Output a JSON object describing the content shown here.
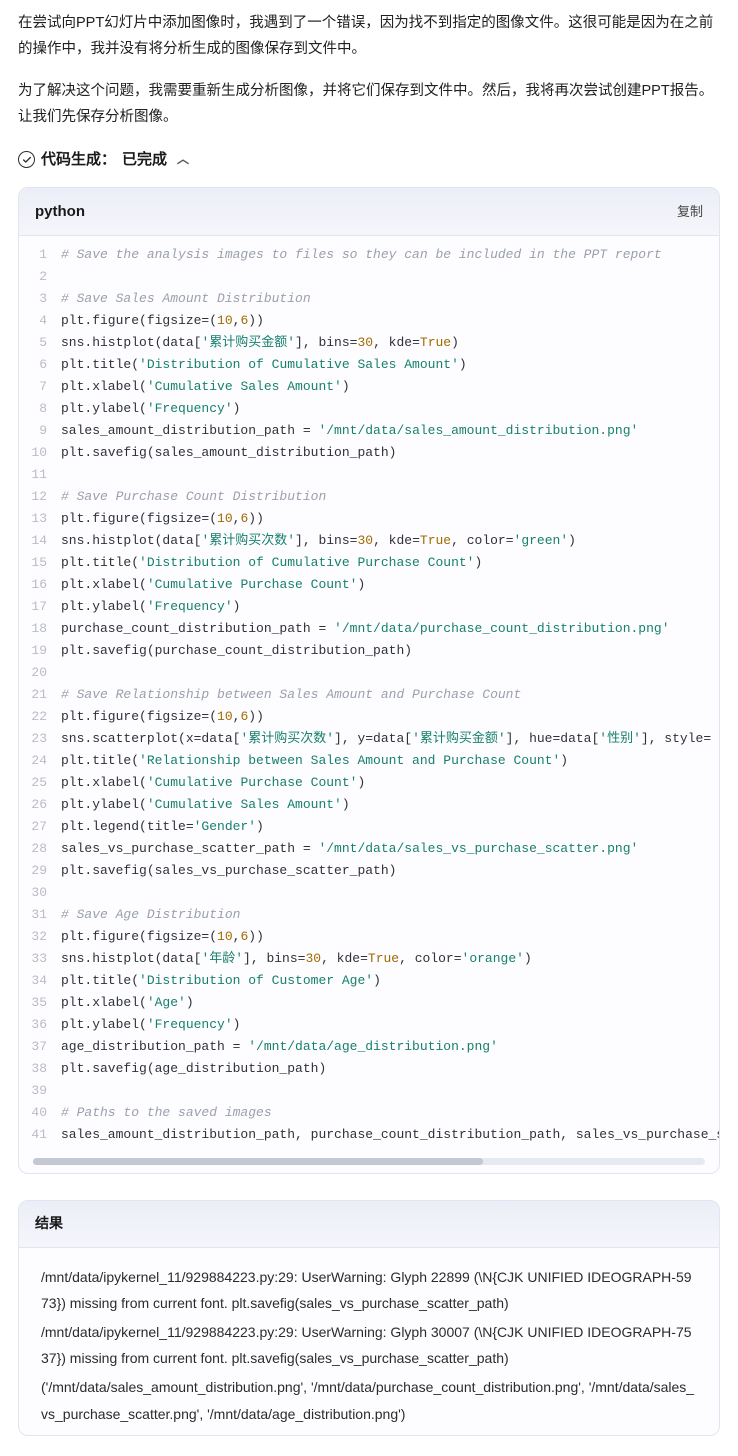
{
  "prose": {
    "p1": "在尝试向PPT幻灯片中添加图像时，我遇到了一个错误，因为找不到指定的图像文件。这很可能是因为在之前的操作中，我并没有将分析生成的图像保存到文件中。",
    "p2": "为了解决这个问题，我需要重新生成分析图像，并将它们保存到文件中。然后，我将再次尝试创建PPT报告。让我们先保存分析图像。"
  },
  "codegen": {
    "label": "代码生成：",
    "status": "已完成"
  },
  "codebox": {
    "lang": "python",
    "copy": "复制",
    "lines": [
      [
        {
          "t": "# Save the analysis images to files so they can be included in the PPT report",
          "c": "c-comment"
        }
      ],
      [],
      [
        {
          "t": "# Save Sales Amount Distribution",
          "c": "c-comment"
        }
      ],
      [
        {
          "t": "plt.figure(figsize=(",
          "c": "c-id"
        },
        {
          "t": "10",
          "c": "c-num"
        },
        {
          "t": ",",
          "c": "c-id"
        },
        {
          "t": "6",
          "c": "c-num"
        },
        {
          "t": "))",
          "c": "c-id"
        }
      ],
      [
        {
          "t": "sns.histplot(data[",
          "c": "c-id"
        },
        {
          "t": "'累计购买金额'",
          "c": "c-str"
        },
        {
          "t": "], bins=",
          "c": "c-id"
        },
        {
          "t": "30",
          "c": "c-num"
        },
        {
          "t": ", kde=",
          "c": "c-id"
        },
        {
          "t": "True",
          "c": "c-kw"
        },
        {
          "t": ")",
          "c": "c-id"
        }
      ],
      [
        {
          "t": "plt.title(",
          "c": "c-id"
        },
        {
          "t": "'Distribution of Cumulative Sales Amount'",
          "c": "c-str"
        },
        {
          "t": ")",
          "c": "c-id"
        }
      ],
      [
        {
          "t": "plt.xlabel(",
          "c": "c-id"
        },
        {
          "t": "'Cumulative Sales Amount'",
          "c": "c-str"
        },
        {
          "t": ")",
          "c": "c-id"
        }
      ],
      [
        {
          "t": "plt.ylabel(",
          "c": "c-id"
        },
        {
          "t": "'Frequency'",
          "c": "c-str"
        },
        {
          "t": ")",
          "c": "c-id"
        }
      ],
      [
        {
          "t": "sales_amount_distribution_path = ",
          "c": "c-id"
        },
        {
          "t": "'/mnt/data/sales_amount_distribution.png'",
          "c": "c-str"
        }
      ],
      [
        {
          "t": "plt.savefig(sales_amount_distribution_path)",
          "c": "c-id"
        }
      ],
      [],
      [
        {
          "t": "# Save Purchase Count Distribution",
          "c": "c-comment"
        }
      ],
      [
        {
          "t": "plt.figure(figsize=(",
          "c": "c-id"
        },
        {
          "t": "10",
          "c": "c-num"
        },
        {
          "t": ",",
          "c": "c-id"
        },
        {
          "t": "6",
          "c": "c-num"
        },
        {
          "t": "))",
          "c": "c-id"
        }
      ],
      [
        {
          "t": "sns.histplot(data[",
          "c": "c-id"
        },
        {
          "t": "'累计购买次数'",
          "c": "c-str"
        },
        {
          "t": "], bins=",
          "c": "c-id"
        },
        {
          "t": "30",
          "c": "c-num"
        },
        {
          "t": ", kde=",
          "c": "c-id"
        },
        {
          "t": "True",
          "c": "c-kw"
        },
        {
          "t": ", color=",
          "c": "c-id"
        },
        {
          "t": "'green'",
          "c": "c-str"
        },
        {
          "t": ")",
          "c": "c-id"
        }
      ],
      [
        {
          "t": "plt.title(",
          "c": "c-id"
        },
        {
          "t": "'Distribution of Cumulative Purchase Count'",
          "c": "c-str"
        },
        {
          "t": ")",
          "c": "c-id"
        }
      ],
      [
        {
          "t": "plt.xlabel(",
          "c": "c-id"
        },
        {
          "t": "'Cumulative Purchase Count'",
          "c": "c-str"
        },
        {
          "t": ")",
          "c": "c-id"
        }
      ],
      [
        {
          "t": "plt.ylabel(",
          "c": "c-id"
        },
        {
          "t": "'Frequency'",
          "c": "c-str"
        },
        {
          "t": ")",
          "c": "c-id"
        }
      ],
      [
        {
          "t": "purchase_count_distribution_path = ",
          "c": "c-id"
        },
        {
          "t": "'/mnt/data/purchase_count_distribution.png'",
          "c": "c-str"
        }
      ],
      [
        {
          "t": "plt.savefig(purchase_count_distribution_path)",
          "c": "c-id"
        }
      ],
      [],
      [
        {
          "t": "# Save Relationship between Sales Amount and Purchase Count",
          "c": "c-comment"
        }
      ],
      [
        {
          "t": "plt.figure(figsize=(",
          "c": "c-id"
        },
        {
          "t": "10",
          "c": "c-num"
        },
        {
          "t": ",",
          "c": "c-id"
        },
        {
          "t": "6",
          "c": "c-num"
        },
        {
          "t": "))",
          "c": "c-id"
        }
      ],
      [
        {
          "t": "sns.scatterplot(x=data[",
          "c": "c-id"
        },
        {
          "t": "'累计购买次数'",
          "c": "c-str"
        },
        {
          "t": "], y=data[",
          "c": "c-id"
        },
        {
          "t": "'累计购买金额'",
          "c": "c-str"
        },
        {
          "t": "], hue=data[",
          "c": "c-id"
        },
        {
          "t": "'性别'",
          "c": "c-str"
        },
        {
          "t": "], style=",
          "c": "c-id"
        }
      ],
      [
        {
          "t": "plt.title(",
          "c": "c-id"
        },
        {
          "t": "'Relationship between Sales Amount and Purchase Count'",
          "c": "c-str"
        },
        {
          "t": ")",
          "c": "c-id"
        }
      ],
      [
        {
          "t": "plt.xlabel(",
          "c": "c-id"
        },
        {
          "t": "'Cumulative Purchase Count'",
          "c": "c-str"
        },
        {
          "t": ")",
          "c": "c-id"
        }
      ],
      [
        {
          "t": "plt.ylabel(",
          "c": "c-id"
        },
        {
          "t": "'Cumulative Sales Amount'",
          "c": "c-str"
        },
        {
          "t": ")",
          "c": "c-id"
        }
      ],
      [
        {
          "t": "plt.legend(title=",
          "c": "c-id"
        },
        {
          "t": "'Gender'",
          "c": "c-str"
        },
        {
          "t": ")",
          "c": "c-id"
        }
      ],
      [
        {
          "t": "sales_vs_purchase_scatter_path = ",
          "c": "c-id"
        },
        {
          "t": "'/mnt/data/sales_vs_purchase_scatter.png'",
          "c": "c-str"
        }
      ],
      [
        {
          "t": "plt.savefig(sales_vs_purchase_scatter_path)",
          "c": "c-id"
        }
      ],
      [],
      [
        {
          "t": "# Save Age Distribution",
          "c": "c-comment"
        }
      ],
      [
        {
          "t": "plt.figure(figsize=(",
          "c": "c-id"
        },
        {
          "t": "10",
          "c": "c-num"
        },
        {
          "t": ",",
          "c": "c-id"
        },
        {
          "t": "6",
          "c": "c-num"
        },
        {
          "t": "))",
          "c": "c-id"
        }
      ],
      [
        {
          "t": "sns.histplot(data[",
          "c": "c-id"
        },
        {
          "t": "'年龄'",
          "c": "c-str"
        },
        {
          "t": "], bins=",
          "c": "c-id"
        },
        {
          "t": "30",
          "c": "c-num"
        },
        {
          "t": ", kde=",
          "c": "c-id"
        },
        {
          "t": "True",
          "c": "c-kw"
        },
        {
          "t": ", color=",
          "c": "c-id"
        },
        {
          "t": "'orange'",
          "c": "c-str"
        },
        {
          "t": ")",
          "c": "c-id"
        }
      ],
      [
        {
          "t": "plt.title(",
          "c": "c-id"
        },
        {
          "t": "'Distribution of Customer Age'",
          "c": "c-str"
        },
        {
          "t": ")",
          "c": "c-id"
        }
      ],
      [
        {
          "t": "plt.xlabel(",
          "c": "c-id"
        },
        {
          "t": "'Age'",
          "c": "c-str"
        },
        {
          "t": ")",
          "c": "c-id"
        }
      ],
      [
        {
          "t": "plt.ylabel(",
          "c": "c-id"
        },
        {
          "t": "'Frequency'",
          "c": "c-str"
        },
        {
          "t": ")",
          "c": "c-id"
        }
      ],
      [
        {
          "t": "age_distribution_path = ",
          "c": "c-id"
        },
        {
          "t": "'/mnt/data/age_distribution.png'",
          "c": "c-str"
        }
      ],
      [
        {
          "t": "plt.savefig(age_distribution_path)",
          "c": "c-id"
        }
      ],
      [],
      [
        {
          "t": "# Paths to the saved images",
          "c": "c-comment"
        }
      ],
      [
        {
          "t": "sales_amount_distribution_path, purchase_count_distribution_path, sales_vs_purchase_s",
          "c": "c-id"
        }
      ]
    ]
  },
  "result": {
    "header": "结果",
    "lines": [
      "/mnt/data/ipykernel_11/929884223.py:29: UserWarning: Glyph 22899 (\\N{CJK UNIFIED IDEOGRAPH-5973}) missing from current font. plt.savefig(sales_vs_purchase_scatter_path)",
      "/mnt/data/ipykernel_11/929884223.py:29: UserWarning: Glyph 30007 (\\N{CJK UNIFIED IDEOGRAPH-7537}) missing from current font. plt.savefig(sales_vs_purchase_scatter_path)",
      "('/mnt/data/sales_amount_distribution.png', '/mnt/data/purchase_count_distribution.png', '/mnt/data/sales_vs_purchase_scatter.png', '/mnt/data/age_distribution.png')"
    ]
  }
}
